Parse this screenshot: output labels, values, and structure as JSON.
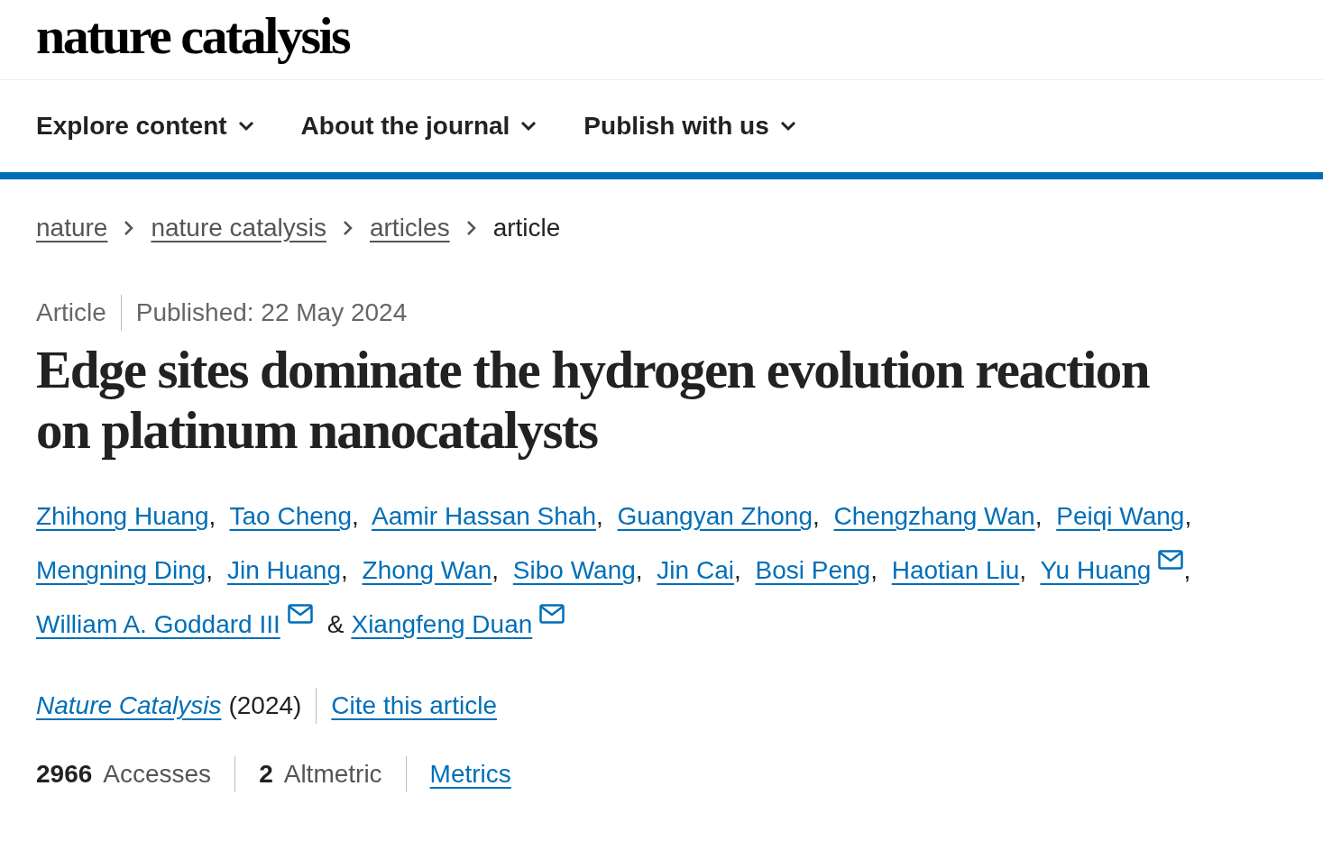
{
  "logo": {
    "text": "nature catalysis"
  },
  "nav": [
    {
      "label": "Explore content"
    },
    {
      "label": "About the journal"
    },
    {
      "label": "Publish with us"
    }
  ],
  "breadcrumbs": [
    {
      "label": "nature",
      "kind": "link"
    },
    {
      "label": "nature catalysis",
      "kind": "link"
    },
    {
      "label": "articles",
      "kind": "link"
    },
    {
      "label": "article",
      "kind": "current"
    }
  ],
  "article": {
    "type": "Article",
    "published": "Published: 22 May 2024",
    "title": "Edge sites dominate the hydrogen evolution reaction on platinum nanocatalysts",
    "authors": [
      {
        "name": "Zhihong Huang",
        "email": false,
        "sep": ","
      },
      {
        "name": "Tao Cheng",
        "email": false,
        "sep": ","
      },
      {
        "name": "Aamir Hassan Shah",
        "email": false,
        "sep": ","
      },
      {
        "name": "Guangyan Zhong",
        "email": false,
        "sep": ","
      },
      {
        "name": "Chengzhang Wan",
        "email": false,
        "sep": ","
      },
      {
        "name": "Peiqi Wang",
        "email": false,
        "sep": ","
      },
      {
        "name": "Mengning Ding",
        "email": false,
        "sep": ","
      },
      {
        "name": "Jin Huang",
        "email": false,
        "sep": ","
      },
      {
        "name": "Zhong Wan",
        "email": false,
        "sep": ","
      },
      {
        "name": "Sibo Wang",
        "email": false,
        "sep": ","
      },
      {
        "name": "Jin Cai",
        "email": false,
        "sep": ","
      },
      {
        "name": "Bosi Peng",
        "email": false,
        "sep": ","
      },
      {
        "name": "Haotian Liu",
        "email": false,
        "sep": ","
      },
      {
        "name": "Yu Huang",
        "email": true,
        "sep": ","
      },
      {
        "name": "William A. Goddard III",
        "email": true,
        "sep": "&"
      },
      {
        "name": "Xiangfeng Duan",
        "email": true
      }
    ],
    "journal": "Nature Catalysis",
    "year": "(2024)",
    "cite": "Cite this article",
    "metrics": [
      {
        "count": "2966",
        "name": "Accesses"
      },
      {
        "count": "2",
        "name": "Altmetric"
      }
    ],
    "metrics_link": "Metrics"
  }
}
